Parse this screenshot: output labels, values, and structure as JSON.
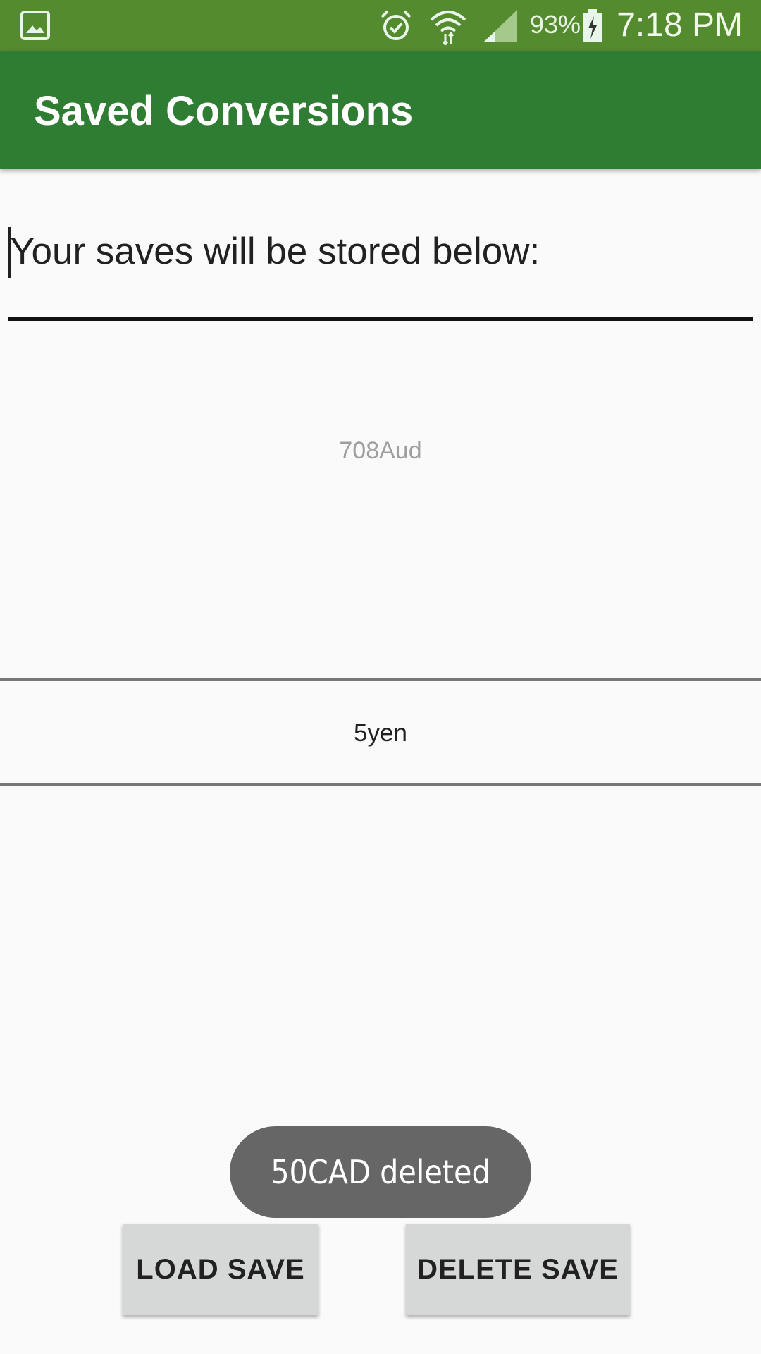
{
  "status_bar": {
    "icons": [
      "gallery-icon",
      "alarm-icon",
      "wifi-icon",
      "signal-icon",
      "battery-charging-icon"
    ],
    "battery_percent": "93%",
    "time": "7:18 PM"
  },
  "app_bar": {
    "title": "Saved Conversions"
  },
  "header": {
    "text": "Your saves will be stored below:"
  },
  "saves": [
    "708Aud",
    "5yen"
  ],
  "toast": {
    "message": "50CAD deleted"
  },
  "buttons": {
    "load": "LOAD SAVE",
    "delete": "DELETE SAVE"
  },
  "colors": {
    "status_bar": "#558b2f",
    "app_bar": "#2e7d32",
    "background": "#fafafa",
    "toast": "#666666",
    "button": "#d6d7d7"
  }
}
